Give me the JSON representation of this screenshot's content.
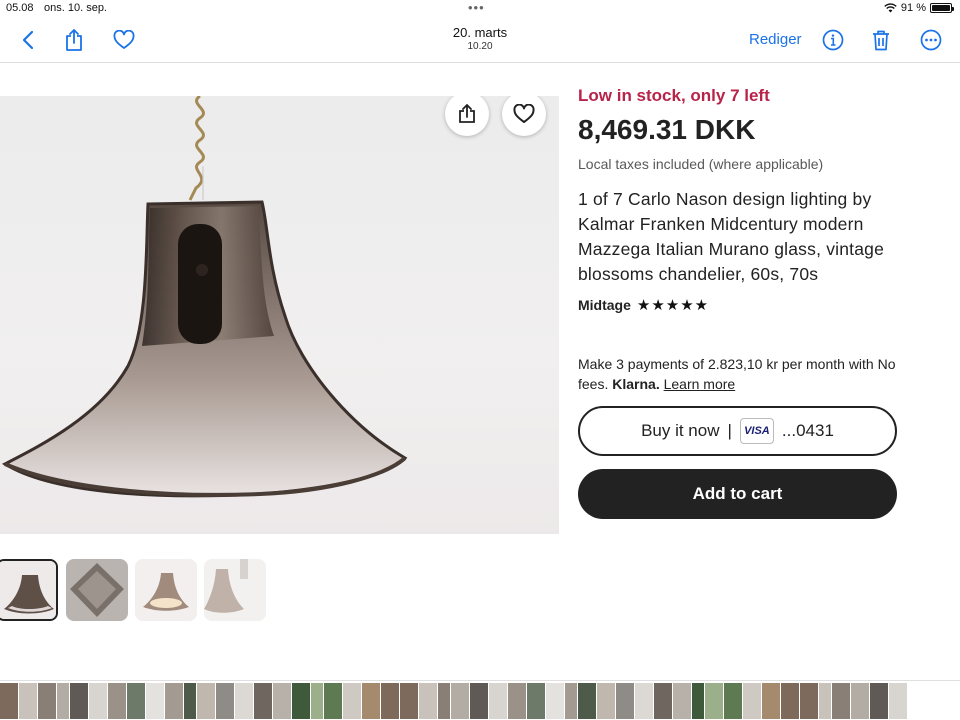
{
  "status_bar": {
    "time": "05.08",
    "date": "ons. 10. sep.",
    "battery": "91 %",
    "battery_level": 0.91
  },
  "toolbar": {
    "title": "20. marts",
    "subtitle": "10.20",
    "edit_label": "Rediger"
  },
  "product": {
    "stock_notice": "Low in stock, only 7 left",
    "price": "8,469.31 DKK",
    "tax_note": "Local taxes included (where applicable)",
    "title": "1 of 7 Carlo Nason design lighting by Kalmar Franken Midcentury modern Mazzega Italian Murano glass, vintage blossoms chandelier, 60s, 70s",
    "shop_name": "Midtage",
    "rating": 5,
    "stars": "★★★★★"
  },
  "payment": {
    "klarna_text": "Make 3 payments of 2.823,10 kr per month with No fees.",
    "klarna_brand": "Klarna.",
    "klarna_link": "Learn more"
  },
  "buttons": {
    "buy_now": "Buy it now",
    "separator": "|",
    "card_brand": "VISA",
    "card_last4": "...0431",
    "add_to_cart": "Add to cart"
  },
  "thumbnails": [
    {
      "selected": true
    },
    {
      "selected": false
    },
    {
      "selected": false
    },
    {
      "selected": false
    }
  ],
  "colors": {
    "accent_link": "#1a73e8",
    "stock_red": "#b8234a",
    "dark_button": "#222222"
  }
}
